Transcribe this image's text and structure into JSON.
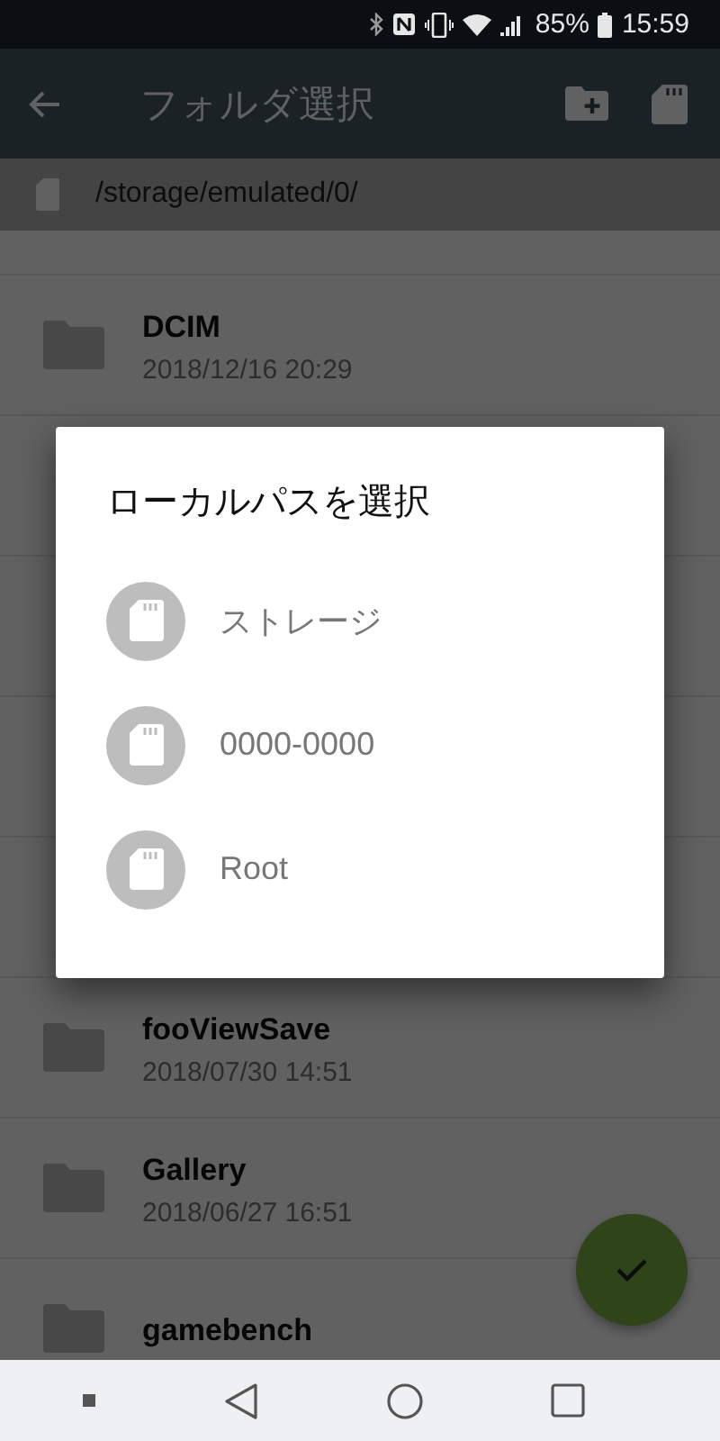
{
  "status_bar": {
    "battery": "85%",
    "time": "15:59"
  },
  "app_bar": {
    "title": "フォルダ選択"
  },
  "path": "/storage/emulated/0/",
  "folders": [
    {
      "name": "DCIM",
      "date": "2018/12/16 20:29"
    },
    {
      "name": "fooViewSave",
      "date": "2018/07/30 14:51"
    },
    {
      "name": "Gallery",
      "date": "2018/06/27 16:51"
    },
    {
      "name": "gamebench"
    }
  ],
  "dialog": {
    "title": "ローカルパスを選択",
    "options": [
      "ストレージ",
      "0000-0000",
      "Root"
    ]
  }
}
